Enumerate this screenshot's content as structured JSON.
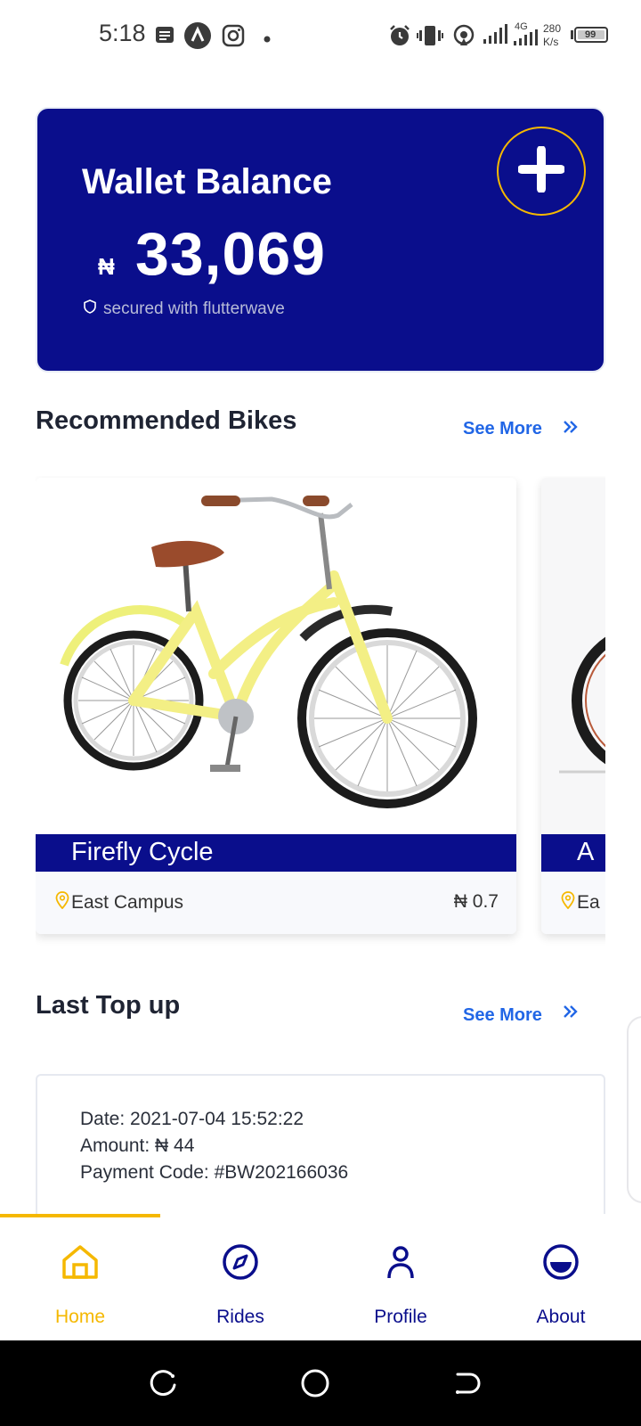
{
  "status_bar": {
    "time": "5:18",
    "network_type": "4G",
    "speed_value": "280",
    "speed_unit": "K/s",
    "battery": "99",
    "icons": [
      "notes-icon",
      "app-icon",
      "instagram-icon",
      "dot-icon",
      "alarm-icon",
      "vibrate-icon",
      "hotspot-icon",
      "signal-icon",
      "signal-icon",
      "battery-icon"
    ]
  },
  "wallet": {
    "title": "Wallet Balance",
    "currency": "₦",
    "amount": "33,069",
    "secured_text": "secured with flutterwave",
    "add_icon": "plus-icon",
    "card_color": "#0a0e8c",
    "ring_color": "#f5b800"
  },
  "recommended": {
    "title": "Recommended Bikes",
    "see_more": "See More",
    "bikes": [
      {
        "name": "Firefly Cycle",
        "location": "East Campus",
        "price": "₦ 0.7"
      },
      {
        "name": "A",
        "location": "Ea",
        "price": ""
      }
    ]
  },
  "last_topup": {
    "title": "Last Top up",
    "see_more": "See More",
    "date_line": "Date: 2021-07-04 15:52:22",
    "amount_line": "Amount: ₦ 44",
    "code_line": "Payment Code: #BW202166036"
  },
  "nav": {
    "items": [
      {
        "label": "Home",
        "icon": "home-icon",
        "active": true
      },
      {
        "label": "Rides",
        "icon": "compass-icon",
        "active": false
      },
      {
        "label": "Profile",
        "icon": "person-icon",
        "active": false
      },
      {
        "label": "About",
        "icon": "about-icon",
        "active": false
      }
    ],
    "active_color": "#f5b800",
    "inactive_color": "#0a0e8c"
  },
  "system_nav": {
    "buttons": [
      "recents-icon",
      "home-circle-icon",
      "back-icon"
    ]
  }
}
